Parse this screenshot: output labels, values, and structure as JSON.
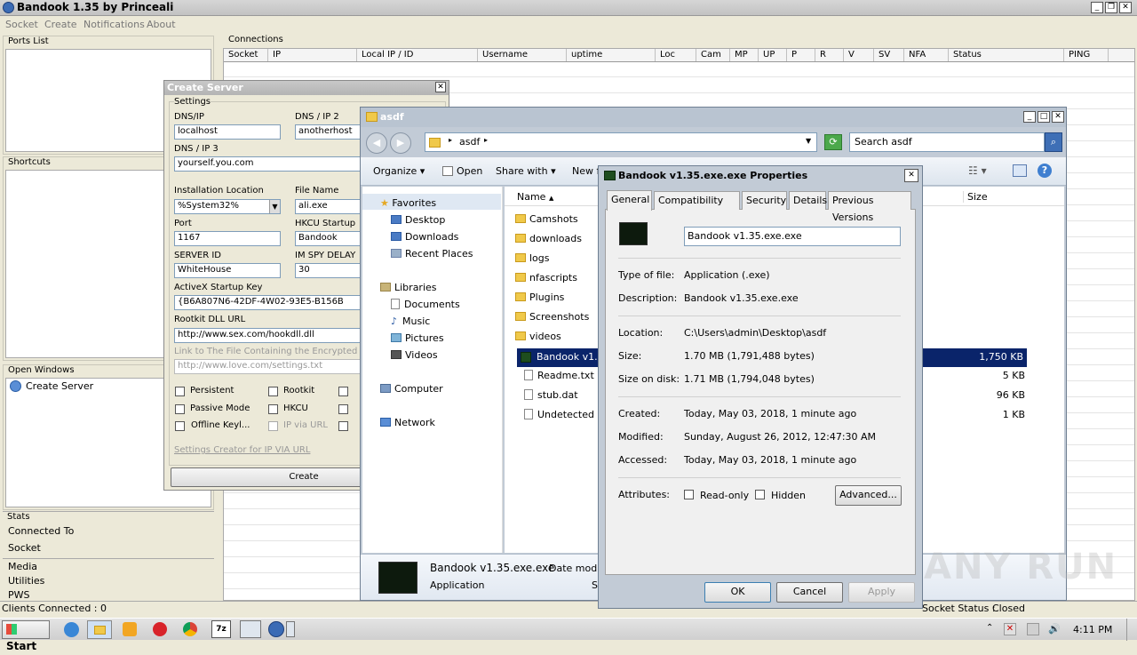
{
  "app": {
    "title": "Bandook 1.35 by Princeali",
    "menu": [
      "Socket",
      "Create",
      "Notifications",
      "About"
    ]
  },
  "left": {
    "ports_label": "Ports List",
    "shortcuts_label": "Shortcuts",
    "open_windows_label": "Open Windows",
    "open_windows_item": "Create Server",
    "stats_label": "Stats",
    "stats_items": [
      "Connected To",
      "Socket"
    ],
    "bottom_items": [
      "Media",
      "Utilities",
      "PWS"
    ]
  },
  "connections": {
    "label": "Connections",
    "columns": [
      "Socket",
      "IP",
      "Local IP / ID",
      "Username",
      "uptime",
      "Loc",
      "Cam",
      "MP",
      "UP",
      "P",
      "R",
      "V",
      "SV",
      "NFA",
      "Status",
      "PING"
    ]
  },
  "status_bar": {
    "clients": "Clients Connected : 0",
    "socket_label": "Socket Status :",
    "socket_value": "Closed"
  },
  "create_server": {
    "title": "Create Server",
    "settings_label": "Settings",
    "dns_label": "DNS/IP",
    "dns_value": "localhost",
    "dns2_label": "DNS / IP 2",
    "dns2_value": "anotherhost",
    "dns3_label": "DNS / IP 3",
    "dns3_value": "yourself.you.com",
    "install_label": "Installation Location",
    "install_value": "%System32%",
    "filename_label": "File Name",
    "filename_value": "ali.exe",
    "port_label": "Port",
    "port_value": "1167",
    "hkcu_label": "HKCU Startup",
    "hkcu_value": "Bandook",
    "server_id_label": "SERVER ID",
    "server_id_value": "WhiteHouse",
    "imspy_label": "IM SPY DELAY",
    "imspy_value": "30",
    "activex_label": "ActiveX Startup Key",
    "activex_value": "{B6A807N6-42DF-4W02-93E5-B156B",
    "rootkit_label": "Rootkit DLL URL",
    "rootkit_value": "http://www.sex.com/hookdll.dll",
    "link_label": "Link to The File Containing the Encrypted",
    "link_value": "http://www.love.com/settings.txt",
    "checks": [
      "Persistent",
      "Rootkit",
      "Passive Mode",
      "HKCU",
      "Offline Keyl...",
      "IP via URL"
    ],
    "settings_creator": "Settings Creator for IP VIA URL",
    "create_btn": "Create"
  },
  "explorer": {
    "title": "asdf",
    "path": "asdf",
    "search_placeholder": "Search asdf",
    "toolbar": [
      "Organize",
      "Open",
      "Share with",
      "New f"
    ],
    "nav": {
      "favorites": "Favorites",
      "fav_items": [
        "Desktop",
        "Downloads",
        "Recent Places"
      ],
      "libraries": "Libraries",
      "lib_items": [
        "Documents",
        "Music",
        "Pictures",
        "Videos"
      ],
      "computer": "Computer",
      "network": "Network"
    },
    "col_name": "Name",
    "col_size": "Size",
    "files": [
      {
        "name": "Camshots",
        "type": "folder",
        "size": ""
      },
      {
        "name": "downloads",
        "type": "folder",
        "size": ""
      },
      {
        "name": "logs",
        "type": "folder",
        "size": ""
      },
      {
        "name": "nfascripts",
        "type": "folder",
        "size": ""
      },
      {
        "name": "Plugins",
        "type": "folder",
        "size": ""
      },
      {
        "name": "Screenshots",
        "type": "folder",
        "size": ""
      },
      {
        "name": "videos",
        "type": "folder",
        "size": ""
      },
      {
        "name": "Bandook v1.35",
        "type": "exe",
        "size": "1,750 KB"
      },
      {
        "name": "Readme.txt",
        "type": "file",
        "size": "5 KB"
      },
      {
        "name": "stub.dat",
        "type": "file",
        "size": "96 KB"
      },
      {
        "name": "Undetected Co",
        "type": "file",
        "size": "1 KB"
      }
    ],
    "details_name": "Bandook v1.35.exe.exe",
    "details_date": "Date modifi",
    "details_type": "Application",
    "details_s": "S"
  },
  "props": {
    "title": "Bandook v1.35.exe.exe Properties",
    "tabs": [
      "General",
      "Compatibility",
      "Security",
      "Details",
      "Previous Versions"
    ],
    "filename": "Bandook v1.35.exe.exe",
    "type_label": "Type of file:",
    "type_value": "Application (.exe)",
    "desc_label": "Description:",
    "desc_value": "Bandook v1.35.exe.exe",
    "loc_label": "Location:",
    "loc_value": "C:\\Users\\admin\\Desktop\\asdf",
    "size_label": "Size:",
    "size_value": "1.70 MB (1,791,488 bytes)",
    "disk_label": "Size on disk:",
    "disk_value": "1.71 MB (1,794,048 bytes)",
    "created_label": "Created:",
    "created_value": "Today, May 03, 2018, 1 minute ago",
    "modified_label": "Modified:",
    "modified_value": "Sunday, August 26, 2012, 12:47:30 AM",
    "accessed_label": "Accessed:",
    "accessed_value": "Today, May 03, 2018, 1 minute ago",
    "attr_label": "Attributes:",
    "readonly": "Read-only",
    "hidden": "Hidden",
    "advanced": "Advanced...",
    "ok": "OK",
    "cancel": "Cancel",
    "apply": "Apply"
  },
  "taskbar": {
    "start": "Start",
    "time": "4:11 PM"
  },
  "watermark": "ANY RUN"
}
